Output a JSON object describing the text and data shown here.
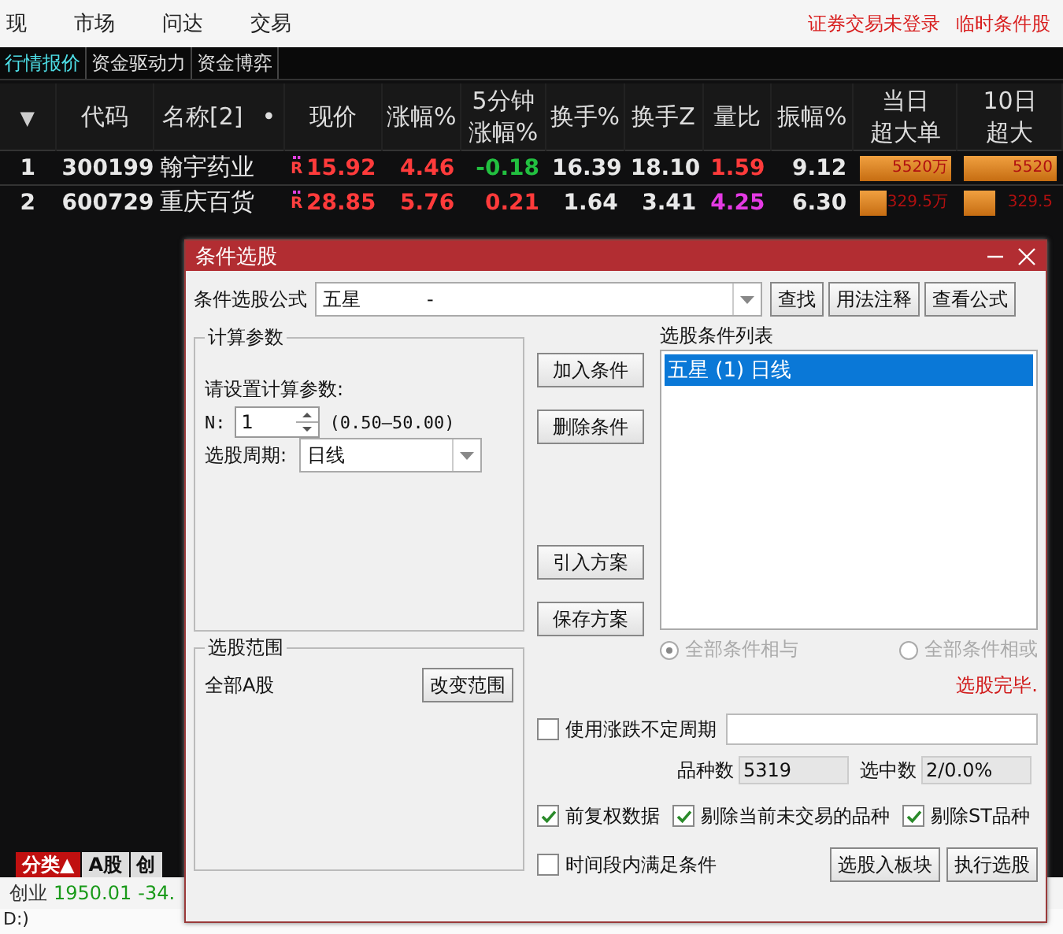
{
  "menu": [
    "现",
    "市场",
    "问达",
    "交易"
  ],
  "notices": [
    "证券交易未登录",
    "临时条件股"
  ],
  "tabs": [
    {
      "label": "行情报价",
      "selected": true
    },
    {
      "label": "资金驱动力",
      "selected": false
    },
    {
      "label": "资金博弈",
      "selected": false
    }
  ],
  "table": {
    "sort_mark": "▼",
    "columns": [
      {
        "label": "代码"
      },
      {
        "label": "名称[2]",
        "extra": "•"
      },
      {
        "label": "现价"
      },
      {
        "label": "涨幅%"
      },
      {
        "label": "5分钟",
        "line2": "涨幅%"
      },
      {
        "label": "换手%"
      },
      {
        "label": "换手Z"
      },
      {
        "label": "量比"
      },
      {
        "label": "振幅%"
      },
      {
        "label": "当日",
        "line2": "超大单"
      },
      {
        "label": "10日",
        "line2": "超大"
      }
    ],
    "rows": [
      {
        "index": "1",
        "code": "300199",
        "name": "翰宇药业",
        "flag": "R",
        "price": "15.92",
        "change": "4.46",
        "change_5min": {
          "text": "-0.18",
          "color": "#22c040"
        },
        "turnover": "16.39",
        "turnover_z": "18.10",
        "volume_ratio": {
          "text": "1.59",
          "color": "#ff3b3b"
        },
        "amplitude": "9.12",
        "bars": [
          {
            "level": 1,
            "text": "5520万"
          },
          {
            "level": 1,
            "text": "5520"
          }
        ]
      },
      {
        "index": "2",
        "code": "600729",
        "name": "重庆百货",
        "flag": "R",
        "price": "28.85",
        "change": "5.76",
        "change_5min": {
          "text": "0.21",
          "color": "#ff3b3b"
        },
        "turnover": "1.64",
        "turnover_z": "3.41",
        "volume_ratio": {
          "text": "4.25",
          "color": "#e43ae4"
        },
        "amplitude": "6.30",
        "bars": [
          {
            "level": 0.3,
            "text": "329.5万"
          },
          {
            "level": 0.35,
            "text": "329.5"
          }
        ]
      }
    ]
  },
  "bottom_tabs": [
    {
      "label": "分类▲",
      "selected": true
    },
    {
      "label": "A股",
      "selected": false
    },
    {
      "label": "创",
      "selected": false
    }
  ],
  "ticker": {
    "name": "创业",
    "value": "1950.01",
    "change": "-34."
  },
  "status_text": "D:)",
  "dialog": {
    "title": "条件选股",
    "formula_label": "条件选股公式",
    "formula_value": "五星           -",
    "top_buttons": [
      "查找",
      "用法注释",
      "查看公式"
    ],
    "params": {
      "legend": "计算参数",
      "prompt": "请设置计算参数:",
      "n_label": "N:",
      "n_value": "1",
      "range": "(0.50—50.00)",
      "period_label": "选股周期:",
      "period_value": "日线"
    },
    "scope": {
      "legend": "选股范围",
      "value": "全部A股",
      "button": "改变范围"
    },
    "side_buttons": [
      "加入条件",
      "删除条件",
      "引入方案",
      "保存方案"
    ],
    "list_label": "选股条件列表",
    "conditions": [
      {
        "text": "五星 (1) 日线",
        "selected": true
      }
    ],
    "logic": [
      {
        "label": "全部条件相与",
        "selected": true,
        "disabled": true
      },
      {
        "label": "全部条件相或",
        "selected": false,
        "disabled": true
      }
    ],
    "status": "选股完毕.",
    "variable_period": {
      "label": "使用涨跌不定周期",
      "checked": false
    },
    "counts": [
      {
        "label": "品种数",
        "value": "5319"
      },
      {
        "label": "选中数",
        "value": "2/0.0%"
      }
    ],
    "options": [
      {
        "label": "前复权数据",
        "checked": true
      },
      {
        "label": "剔除当前未交易的品种",
        "checked": true
      },
      {
        "label": "剔除ST品种",
        "checked": true
      }
    ],
    "time_condition": {
      "label": "时间段内满足条件",
      "checked": false
    },
    "bottom_buttons": [
      "选股入板块",
      "执行选股"
    ]
  }
}
